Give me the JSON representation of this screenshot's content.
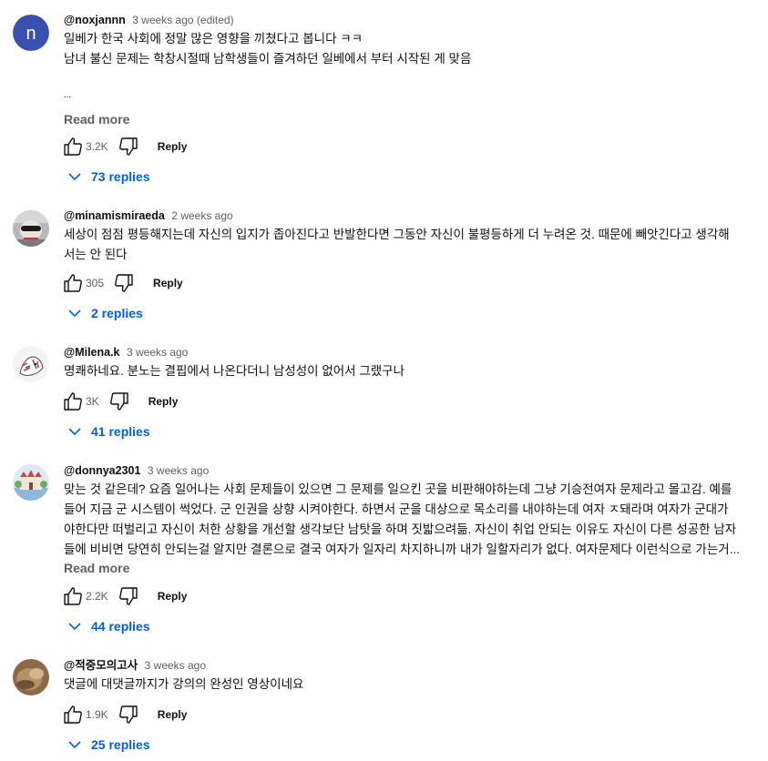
{
  "comments": [
    {
      "author": "@noxjannn",
      "time": "3 weeks ago (edited)",
      "lines": [
        "일베가 한국 사회에 정말 많은 영향을 끼쳤다고 봅니다 ㅋㅋ",
        "남녀 불신 문제는 학창시절때 남학생들이 즐겨하던 일베에서 부터 시작된 게 맞음",
        "",
        "..."
      ],
      "read_more": "Read more",
      "likes": "3.2K",
      "reply_label": "Reply",
      "replies_label": "73 replies",
      "avatar": {
        "type": "letter",
        "letter": "n",
        "color": "#3f51b5"
      }
    },
    {
      "author": "@minamismiraeda",
      "time": "2 weeks ago",
      "lines": [
        "세상이 점점 평등해지는데 자신의 입지가 좁아진다고 반발한다면 그동안 자신이 불평등하게 더 누려온 것. 때문에 빼앗긴다고 생각해",
        "서는 안 된다"
      ],
      "read_more": "",
      "likes": "305",
      "reply_label": "Reply",
      "replies_label": "2 replies",
      "avatar": {
        "type": "photo-figure"
      }
    },
    {
      "author": "@Milena.k",
      "time": "3 weeks ago",
      "lines": [
        "명쾌하네요. 분노는 결핍에서 나온다더니 남성성이 없어서 그랬구나"
      ],
      "read_more": "",
      "likes": "3K",
      "reply_label": "Reply",
      "replies_label": "41 replies",
      "avatar": {
        "type": "illustration-cat"
      }
    },
    {
      "author": "@donnya2301",
      "time": "3 weeks ago",
      "lines": [
        "맞는 것 같은데? 요즘 일어나는 사회 문제들이 있으면 그 문제를 일으킨 곳을 비판해야하는데 그냥 기승전여자 문제라고 몰고감. 예를",
        "들어 지금 군 시스템이 썩었다. 군 인권을 상향 시켜야한다. 하면서 군을 대상으로 목소리를 내야하는데 여자 ㅈ돼라며 여자가 군대가",
        "야한다만 떠벌리고 자신이 처한 상황을 개선할 생각보단 남탓을 하며 짓밟으려듦. 자신이 취업 안되는 이유도 자신이 다른 성공한 남자",
        "들에 비비면 당연히 안되는걸 알지만 결론으로 결국 여자가 일자리 차지하니까 내가 일할자리가 없다. 여자문제다 이런식으로 가는거..."
      ],
      "read_more": "Read more",
      "likes": "2.2K",
      "reply_label": "Reply",
      "replies_label": "44 replies",
      "avatar": {
        "type": "illustration-castle"
      }
    },
    {
      "author": "@적중모의고사",
      "time": "3 weeks ago",
      "lines": [
        "댓글에 대댓글까지가 강의의 완성인 영상이네요"
      ],
      "read_more": "",
      "likes": "1.9K",
      "reply_label": "Reply",
      "replies_label": "25 replies",
      "avatar": {
        "type": "photo-brown"
      }
    }
  ]
}
